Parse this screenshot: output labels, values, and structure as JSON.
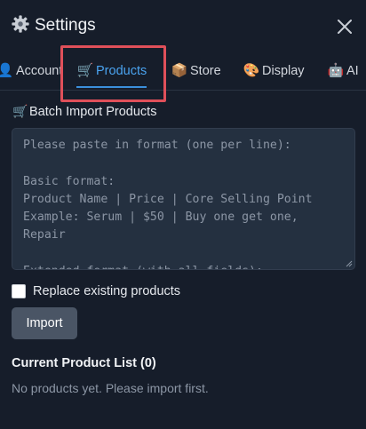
{
  "header": {
    "title": "Settings",
    "icon": "gear-icon",
    "close_icon": "close-icon"
  },
  "tabs": [
    {
      "label": "Account",
      "icon": "user-icon",
      "active": false
    },
    {
      "label": "Products",
      "icon": "cart-icon",
      "active": true
    },
    {
      "label": "Store",
      "icon": "package-icon",
      "active": false
    },
    {
      "label": "Display",
      "icon": "palette-icon",
      "active": false
    },
    {
      "label": "AI",
      "icon": "robot-icon",
      "active": false
    }
  ],
  "batch_import": {
    "title": "Batch Import Products",
    "icon": "cart-icon",
    "placeholder": "Please paste in format (one per line):\n\nBasic format:\nProduct Name | Price | Core Selling Point\nExample: Serum | $50 | Buy one get one, Repair\n\nExtended format (with all fields):",
    "replace_label": "Replace existing products",
    "replace_checked": false,
    "import_label": "Import"
  },
  "product_list": {
    "title": "Current Product List (0)",
    "empty_text": "No products yet. Please import first."
  },
  "colors": {
    "background": "#161d2a",
    "accent": "#3b8fdc",
    "highlight": "#e0505a"
  }
}
